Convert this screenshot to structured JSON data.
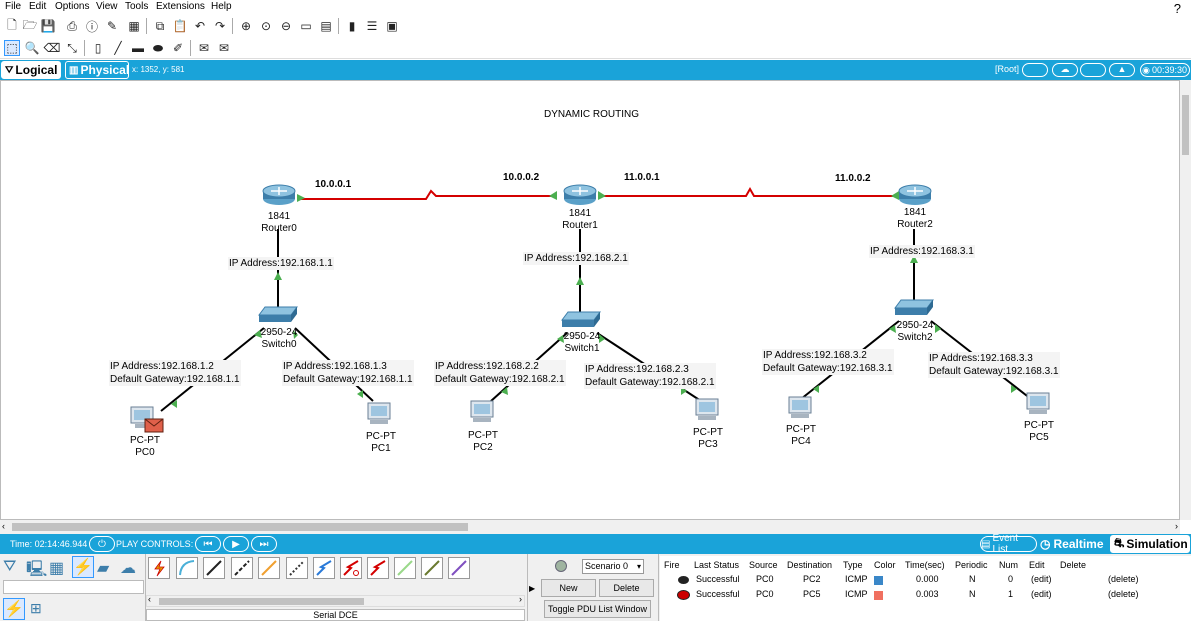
{
  "menu": [
    "File",
    "Edit",
    "Options",
    "View",
    "Tools",
    "Extensions",
    "Help"
  ],
  "help_symbol": "?",
  "mode_bar": {
    "logical_label": "Logical",
    "physical_label": "Physical",
    "coords": "x: 1352, y: 581",
    "root_label": "[Root]",
    "clock": "00:39:30"
  },
  "canvas": {
    "title": "DYNAMIC ROUTING",
    "links": [
      {
        "from": "Router0",
        "to": "Router1",
        "left_ip": "10.0.0.1",
        "right_ip": "10.0.0.2",
        "type": "serial",
        "color": "#d40000"
      },
      {
        "from": "Router1",
        "to": "Router2",
        "left_ip": "11.0.0.1",
        "right_ip": "11.0.0.2",
        "type": "serial",
        "color": "#d40000"
      }
    ],
    "routers": [
      {
        "model": "1841",
        "name": "Router0",
        "ip_label": "IP Address:192.168.1.1"
      },
      {
        "model": "1841",
        "name": "Router1",
        "ip_label": "IP Address:192.168.2.1"
      },
      {
        "model": "1841",
        "name": "Router2",
        "ip_label": "IP Address:192.168.3.1"
      }
    ],
    "switches": [
      {
        "model": "2950-24",
        "name": "Switch0"
      },
      {
        "model": "2950-24",
        "name": "Switch1"
      },
      {
        "model": "2950-24",
        "name": "Switch2"
      }
    ],
    "pcs": [
      {
        "model": "PC-PT",
        "name": "PC0",
        "ip": "IP Address:192.168.1.2",
        "gateway": "Default Gateway:192.168.1.1",
        "has_envelope": true
      },
      {
        "model": "PC-PT",
        "name": "PC1",
        "ip": "IP Address:192.168.1.3",
        "gateway": "Default Gateway:192.168.1.1"
      },
      {
        "model": "PC-PT",
        "name": "PC2",
        "ip": "IP Address:192.168.2.2",
        "gateway": "Default Gateway:192.168.2.1"
      },
      {
        "model": "PC-PT",
        "name": "PC3",
        "ip": "IP Address:192.168.2.3",
        "gateway": "Default Gateway:192.168.2.1"
      },
      {
        "model": "PC-PT",
        "name": "PC4",
        "ip": "IP Address:192.168.3.2",
        "gateway": "Default Gateway:192.168.3.1"
      },
      {
        "model": "PC-PT",
        "name": "PC5",
        "ip": "IP Address:192.168.3.3",
        "gateway": "Default Gateway:192.168.3.1"
      }
    ],
    "link_up_color": "#4caf50"
  },
  "status_bar": {
    "time": "Time: 02:14:46.944",
    "play_controls": "PLAY CONTROLS:",
    "event_list": "Event List",
    "realtime": "Realtime",
    "simulation": "Simulation"
  },
  "bottom": {
    "connection_type_label": "Serial DCE",
    "scenario": "Scenario 0",
    "new_button": "New",
    "delete_button": "Delete",
    "toggle_pdu_button": "Toggle PDU List Window",
    "pdu_headers": [
      "Fire",
      "Last Status",
      "Source",
      "Destination",
      "Type",
      "Color",
      "Time(sec)",
      "Periodic",
      "Num",
      "Edit",
      "Delete"
    ],
    "pdu_rows": [
      {
        "last_status": "Successful",
        "source": "PC0",
        "destination": "PC2",
        "type": "ICMP",
        "color": "#3a87c8",
        "time": "0.000",
        "periodic": "N",
        "num": "0",
        "edit": "(edit)",
        "delete": "(delete)"
      },
      {
        "last_status": "Successful",
        "source": "PC0",
        "destination": "PC5",
        "type": "ICMP",
        "color": "#f07060",
        "time": "0.003",
        "periodic": "N",
        "num": "1",
        "edit": "(edit)",
        "delete": "(delete)"
      }
    ]
  }
}
